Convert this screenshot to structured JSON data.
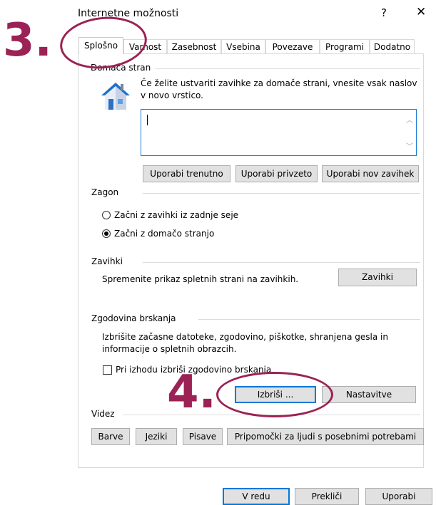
{
  "window": {
    "title": "Internetne možnosti",
    "help_glyph": "?",
    "close_glyph": "✕"
  },
  "tabs": [
    {
      "label": "Splošno",
      "active": true
    },
    {
      "label": "Varnost",
      "active": false
    },
    {
      "label": "Zasebnost",
      "active": false
    },
    {
      "label": "Vsebina",
      "active": false
    },
    {
      "label": "Povezave",
      "active": false
    },
    {
      "label": "Programi",
      "active": false
    },
    {
      "label": "Dodatno",
      "active": false
    }
  ],
  "homepage": {
    "group_label": "Domača stran",
    "description": "Če želite ustvariti zavihke za domače strani, vnesite vsak naslov v novo vrstico.",
    "textarea_value": "",
    "buttons": {
      "use_current": "Uporabi trenutno",
      "use_default": "Uporabi privzeto",
      "use_new_tab": "Uporabi nov zavihek"
    }
  },
  "startup": {
    "group_label": "Zagon",
    "options": [
      {
        "label": "Začni z zavihki iz zadnje seje",
        "checked": false
      },
      {
        "label": "Začni z domačo stranjo",
        "checked": true
      }
    ]
  },
  "tabs_section": {
    "group_label": "Zavihki",
    "description": "Spremenite prikaz spletnih strani na zavihkih.",
    "button": "Zavihki"
  },
  "history": {
    "group_label": "Zgodovina brskanja",
    "description": "Izbrišite začasne datoteke, zgodovino, piškotke, shranjena gesla in informacije o spletnih obrazcih.",
    "checkbox_label": "Pri izhodu izbriši zgodovino brskanja",
    "checkbox_checked": false,
    "delete_button": "Izbriši ...",
    "settings_button": "Nastavitve"
  },
  "appearance": {
    "group_label": "Videz",
    "buttons": [
      "Barve",
      "Jeziki",
      "Pisave",
      "Pripomočki za ljudi s posebnimi potrebami"
    ]
  },
  "footer": {
    "ok": "V redu",
    "cancel": "Prekliči",
    "apply": "Uporabi"
  },
  "annotations": {
    "step3": "3.",
    "step4": "4.",
    "color": "#9b2254"
  }
}
